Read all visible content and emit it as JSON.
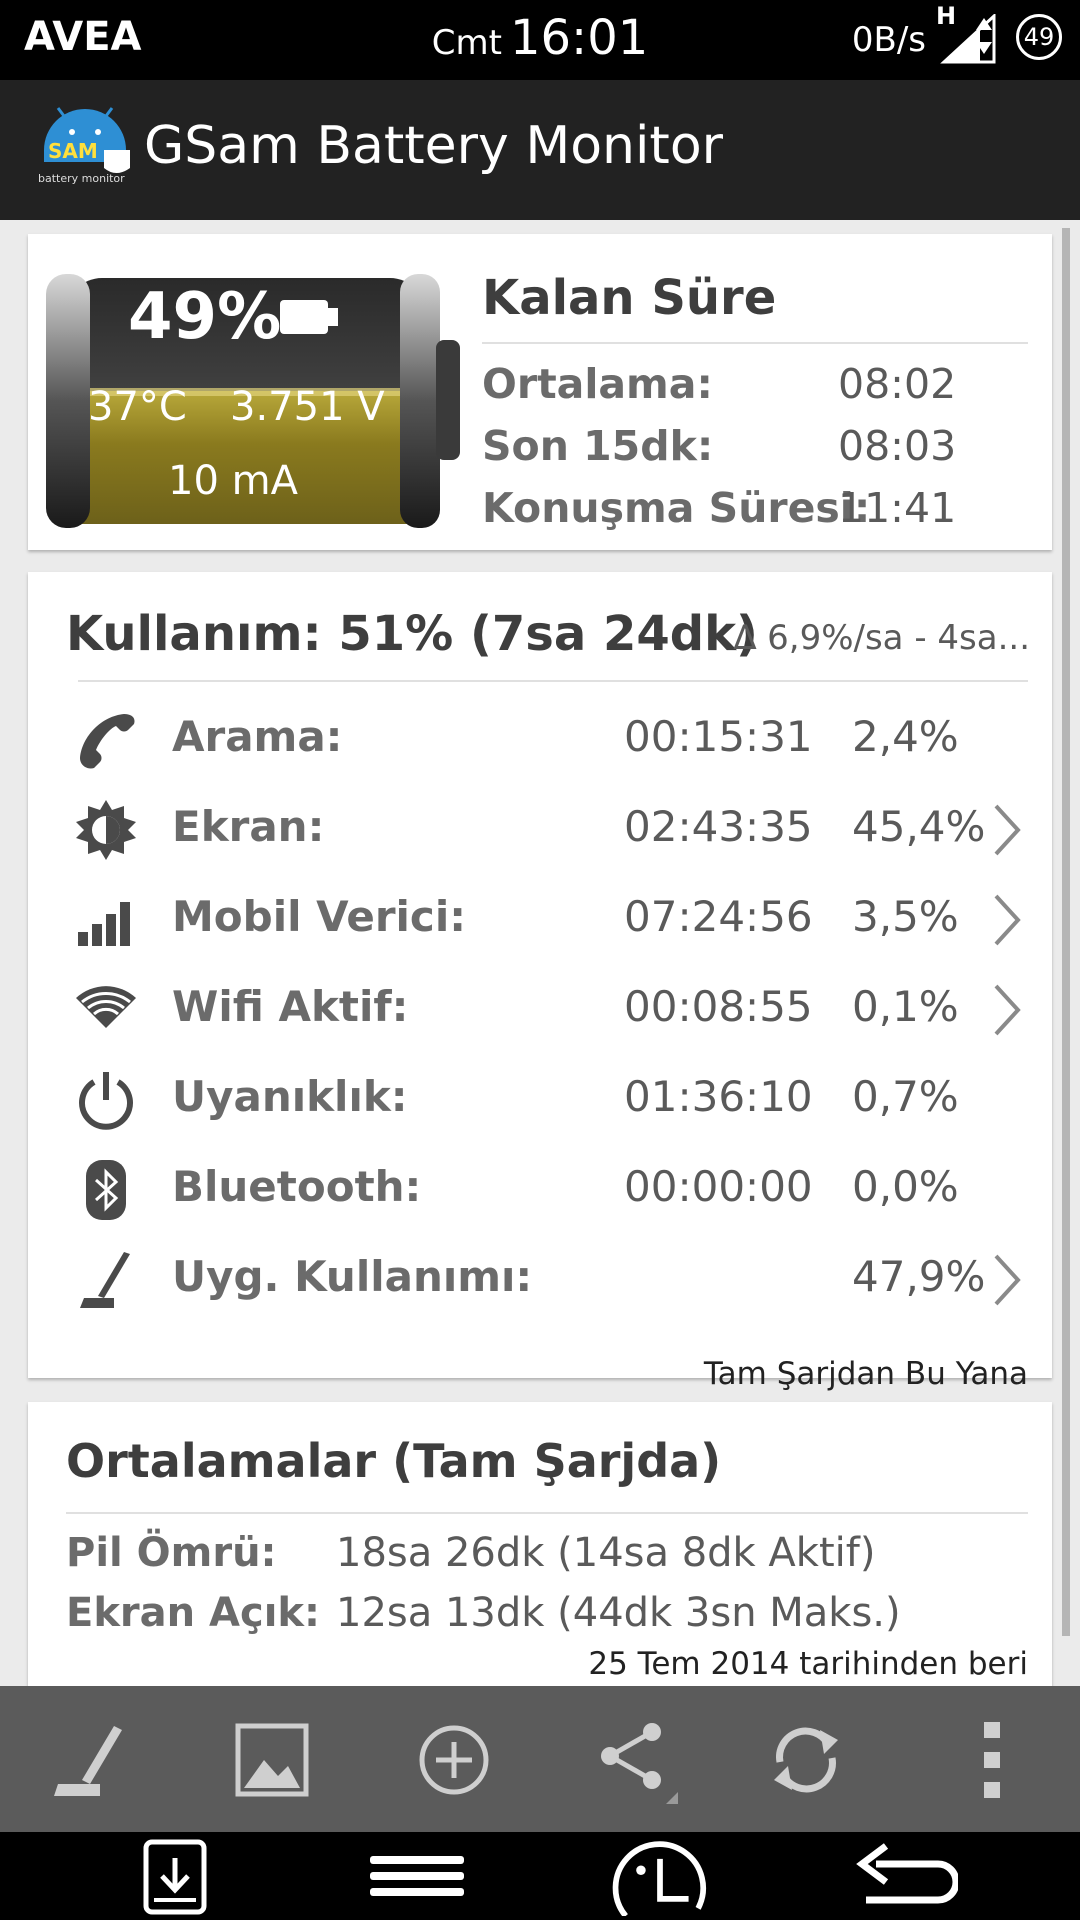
{
  "status_bar": {
    "carrier": "AVEA",
    "day": "Cmt",
    "time": "16:01",
    "net_speed": "0B/s",
    "network_type": "H",
    "battery_level": "49"
  },
  "app": {
    "title": "GSam Battery Monitor",
    "logo_text": "SAM",
    "logo_subtext": "battery monitor"
  },
  "battery": {
    "percent_label": "49%",
    "temperature": "37°C",
    "voltage": "3.751 V",
    "current": "10 mA",
    "fill_level": 0.49
  },
  "remaining": {
    "title": "Kalan Süre",
    "rows": [
      {
        "label": "Ortalama:",
        "value": "08:02"
      },
      {
        "label": "Son 15dk:",
        "value": "08:03"
      },
      {
        "label": "Konuşma Süresi:",
        "value": "11:41"
      }
    ]
  },
  "usage": {
    "title": "Kullanım: 51% (7sa 24dk)",
    "rate": "∆ 6,9%/sa - 4sa...",
    "rows": [
      {
        "icon": "phone-icon",
        "label": "Arama:",
        "time": "00:15:31",
        "percent": "2,4%",
        "has_detail": false
      },
      {
        "icon": "brightness-icon",
        "label": "Ekran:",
        "time": "02:43:35",
        "percent": "45,4%",
        "has_detail": true
      },
      {
        "icon": "cell-signal-icon",
        "label": "Mobil Verici:",
        "time": "07:24:56",
        "percent": "3,5%",
        "has_detail": true
      },
      {
        "icon": "wifi-icon",
        "label": "Wifi Aktif:",
        "time": "00:08:55",
        "percent": "0,1%",
        "has_detail": true
      },
      {
        "icon": "power-icon",
        "label": "Uyanıklık:",
        "time": "01:36:10",
        "percent": "0,7%",
        "has_detail": false
      },
      {
        "icon": "bluetooth-icon",
        "label": "Bluetooth:",
        "time": "00:00:00",
        "percent": "0,0%",
        "has_detail": false
      },
      {
        "icon": "app-usage-icon",
        "label": "Uyg. Kullanımı:",
        "time": "",
        "percent": "47,9%",
        "has_detail": true
      }
    ],
    "footer": "Tam Şarjdan Bu Yana"
  },
  "averages": {
    "title": "Ortalamalar (Tam Şarjda)",
    "rows": [
      {
        "label": "Pil Ömrü:",
        "value": "18sa 26dk (14sa 8dk Aktif)"
      },
      {
        "label": "Ekran Açık:",
        "value": "12sa 13dk (44dk 3sn Maks.)"
      }
    ],
    "footer": "25 Tem 2014 tarihinden beri"
  },
  "toolbar": [
    "app-usage-icon",
    "image-icon",
    "add-icon",
    "share-icon",
    "refresh-icon",
    "overflow-menu-icon"
  ],
  "navbar": [
    "notification-tray-icon",
    "menu-icon",
    "home-icon",
    "back-icon"
  ],
  "colors": {
    "status_bar": "#000000",
    "action_bar": "#222222",
    "toolbar": "#5b5b5b",
    "battery_fill": "#8a7a1e"
  }
}
